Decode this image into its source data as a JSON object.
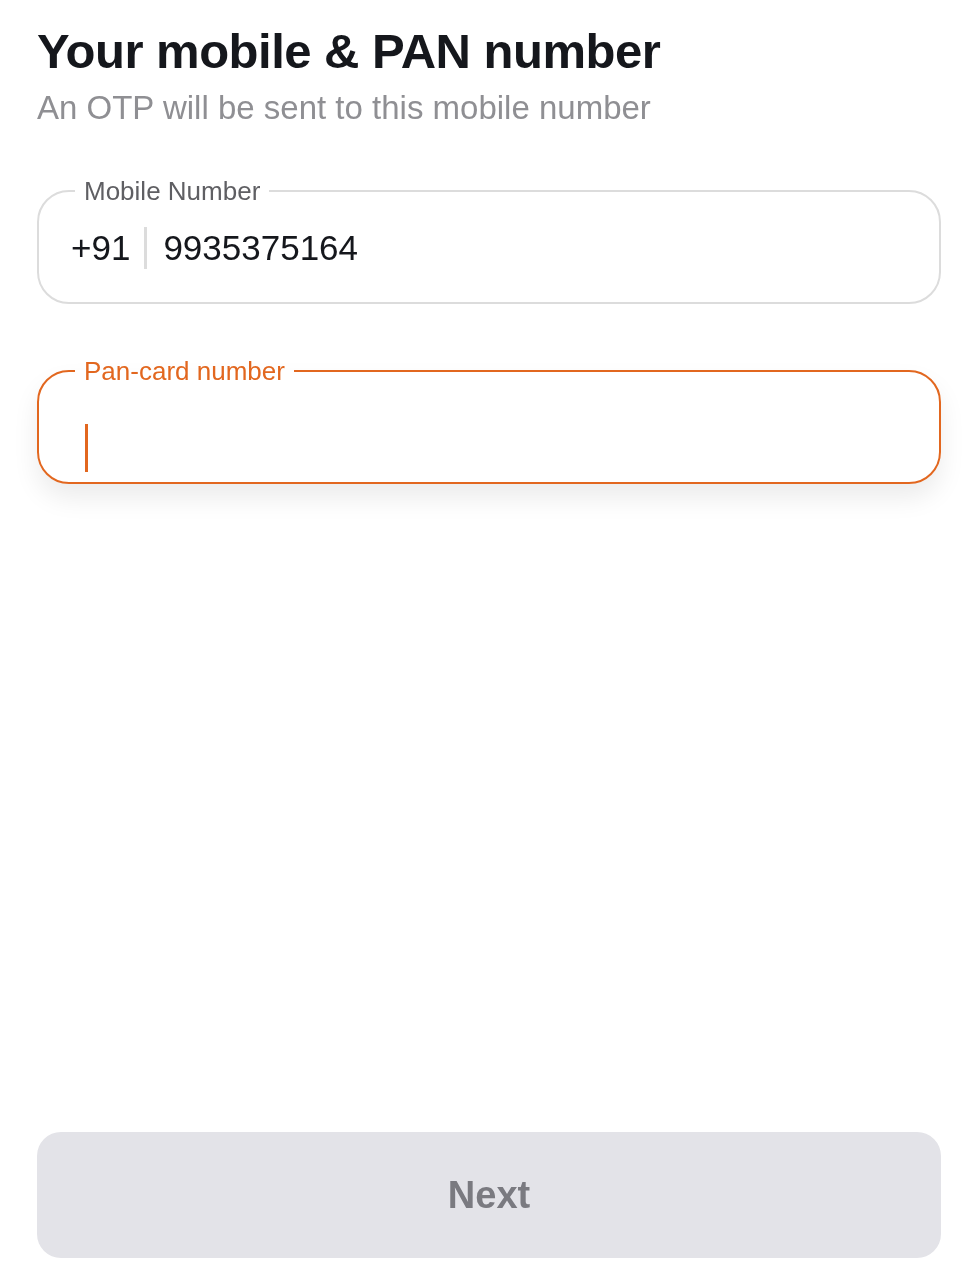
{
  "title": "Your mobile & PAN number",
  "subtitle": "An OTP will be sent to this mobile number",
  "fields": [
    {
      "kind": "phone",
      "label": "Mobile Number",
      "prefix": "+91",
      "value": "9935375164",
      "focused": false
    },
    {
      "kind": "text",
      "label": "Pan-card number",
      "focused": true
    }
  ],
  "button": {
    "label": "Next",
    "disabled": true
  }
}
